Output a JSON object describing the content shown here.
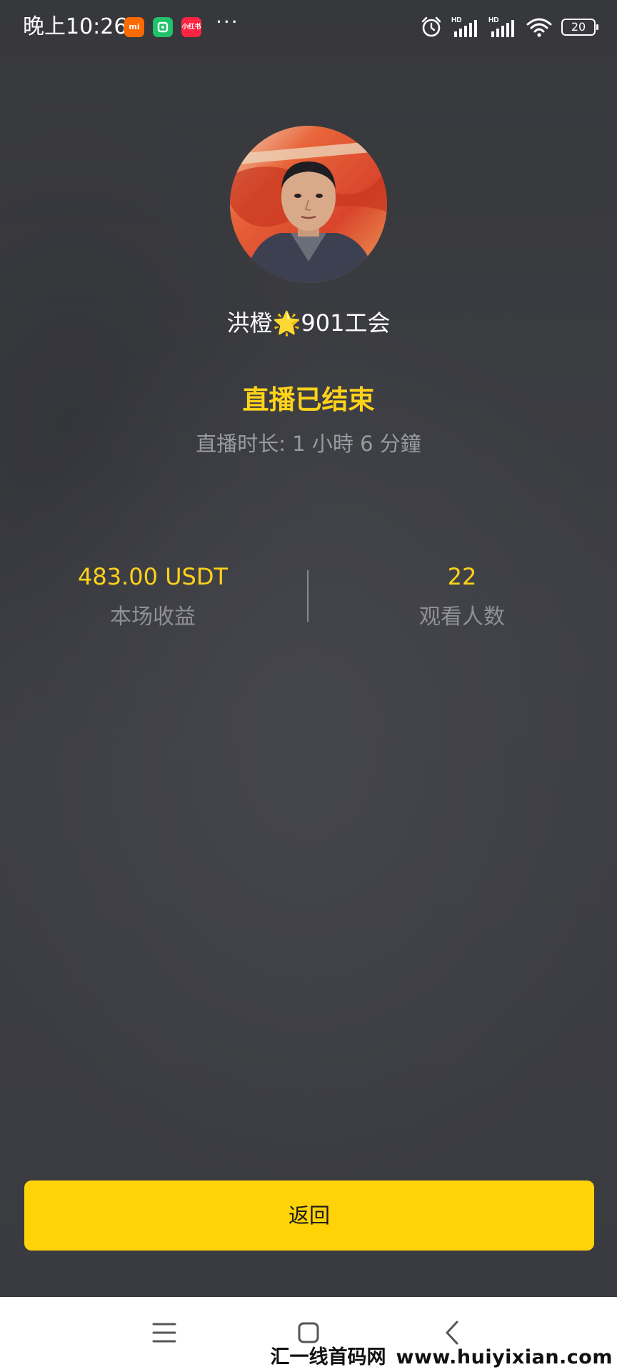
{
  "status_bar": {
    "time": "晚上10:26",
    "app_icons": [
      {
        "name": "mi-icon",
        "label": "mi",
        "color": "#ff6a00"
      },
      {
        "name": "mijia-icon",
        "label": "",
        "color": "#20c26a"
      },
      {
        "name": "xiaohongshu-icon",
        "label": "小红书",
        "color": "#ff2442"
      }
    ],
    "more": "···",
    "signal_1_tag": "HD",
    "signal_2_tag": "HD",
    "battery_level": "20"
  },
  "profile": {
    "name": "洪橙🌟901工会",
    "avatar_icon": "streamer-avatar"
  },
  "session": {
    "status_title": "直播已结束",
    "duration_text": "直播时长: 1 小時 6 分鐘"
  },
  "stats": {
    "earnings_value": "483.00 USDT",
    "earnings_label": "本场收益",
    "viewers_value": "22",
    "viewers_label": "观看人数"
  },
  "actions": {
    "return_label": "返回"
  },
  "navigation": {
    "menu_icon": "menu-icon",
    "home_icon": "home-icon",
    "back_icon": "back-icon"
  },
  "watermark": {
    "cn": "汇一线首码网",
    "url": "www.huiyixian.com"
  },
  "colors": {
    "accent": "#ffd21a",
    "button": "#ffd307",
    "background": "#3b3c41",
    "muted_text": "#9a9ba0"
  }
}
